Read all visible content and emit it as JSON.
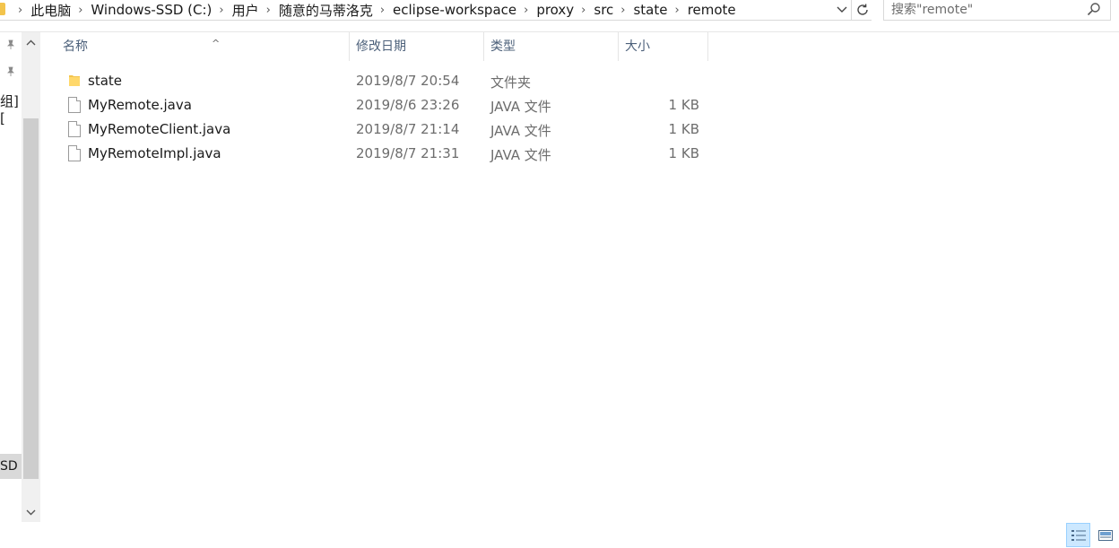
{
  "address": {
    "breadcrumbs": [
      "此电脑",
      "Windows-SSD (C:)",
      "用户",
      "随意的马蒂洛克",
      "eclipse-workspace",
      "proxy",
      "src",
      "state",
      "remote"
    ],
    "dropdown_icon": "chevron-down-icon",
    "refresh_icon": "refresh-icon"
  },
  "search": {
    "placeholder": "搜索\"remote\"",
    "value": ""
  },
  "nav": {
    "partial_item_1": "组][",
    "partial_item_2": "SD ("
  },
  "columns": {
    "name": "名称",
    "date": "修改日期",
    "type": "类型",
    "size": "大小",
    "sort_indicator": "^"
  },
  "files": [
    {
      "name": "state",
      "date": "2019/8/7 20:54",
      "type": "文件夹",
      "size": "",
      "icon": "folder-icon"
    },
    {
      "name": "MyRemote.java",
      "date": "2019/8/6 23:26",
      "type": "JAVA 文件",
      "size": "1 KB",
      "icon": "file-icon"
    },
    {
      "name": "MyRemoteClient.java",
      "date": "2019/8/7 21:14",
      "type": "JAVA 文件",
      "size": "1 KB",
      "icon": "file-icon"
    },
    {
      "name": "MyRemoteImpl.java",
      "date": "2019/8/7 21:31",
      "type": "JAVA 文件",
      "size": "1 KB",
      "icon": "file-icon"
    }
  ],
  "colors": {
    "header_text": "#4c607a",
    "folder": "#f3c44c",
    "selected_view": "#cce8ff"
  }
}
